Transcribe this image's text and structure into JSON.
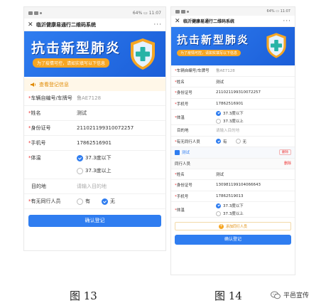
{
  "status": {
    "battery": "64%",
    "time": "11:07"
  },
  "app": {
    "close_symbol": "✕",
    "title": "临沂健康易通行二维码系统",
    "more_symbol": "···"
  },
  "banner": {
    "title": "抗击新型肺炎",
    "subtitle": "为了疫情可控，请如实填写以下信息"
  },
  "notice": {
    "text": "查看登记信息"
  },
  "form": {
    "vehicle": {
      "label": "车辆自编号/车牌号",
      "value": "鲁AE7128"
    },
    "name": {
      "label": "姓名",
      "value": "测试"
    },
    "id": {
      "label": "身份证号",
      "value": "211021199310072257"
    },
    "phone": {
      "label": "手机号",
      "value": "17862516901"
    },
    "temp": {
      "label": "体温",
      "opt1": "37.3度以下",
      "opt2": "37.3度以上"
    },
    "dest": {
      "label": "目的地",
      "placeholder": "请输入目的地"
    },
    "companions": {
      "label": "有无同行人员",
      "yes": "有",
      "no": "无"
    }
  },
  "companion": {
    "checkbox_label": "测试",
    "delete_label": "删除",
    "section_title": "同行人员",
    "name": {
      "label": "姓名",
      "value": "测试"
    },
    "id": {
      "label": "身份证号",
      "value": "130981199104066643"
    },
    "phone": {
      "label": "手机号",
      "value": "17862519013"
    },
    "temp": {
      "label": "体温",
      "opt1": "37.3度以下",
      "opt2": "37.3度以上"
    }
  },
  "add_companion": {
    "icon": "+",
    "label": "添加同行人员"
  },
  "submit": {
    "label": "确认登记"
  },
  "captions": {
    "fig13": "图 13",
    "fig14": "图 14"
  },
  "watermark": {
    "text": "平邑宣传"
  },
  "colors": {
    "primary": "#2f7df0",
    "warning": "#f6a623",
    "danger": "#ee3333"
  },
  "icons": {
    "shield": "shield-cross-icon",
    "notice": "speaker-icon",
    "wechat": "wechat-icon"
  }
}
